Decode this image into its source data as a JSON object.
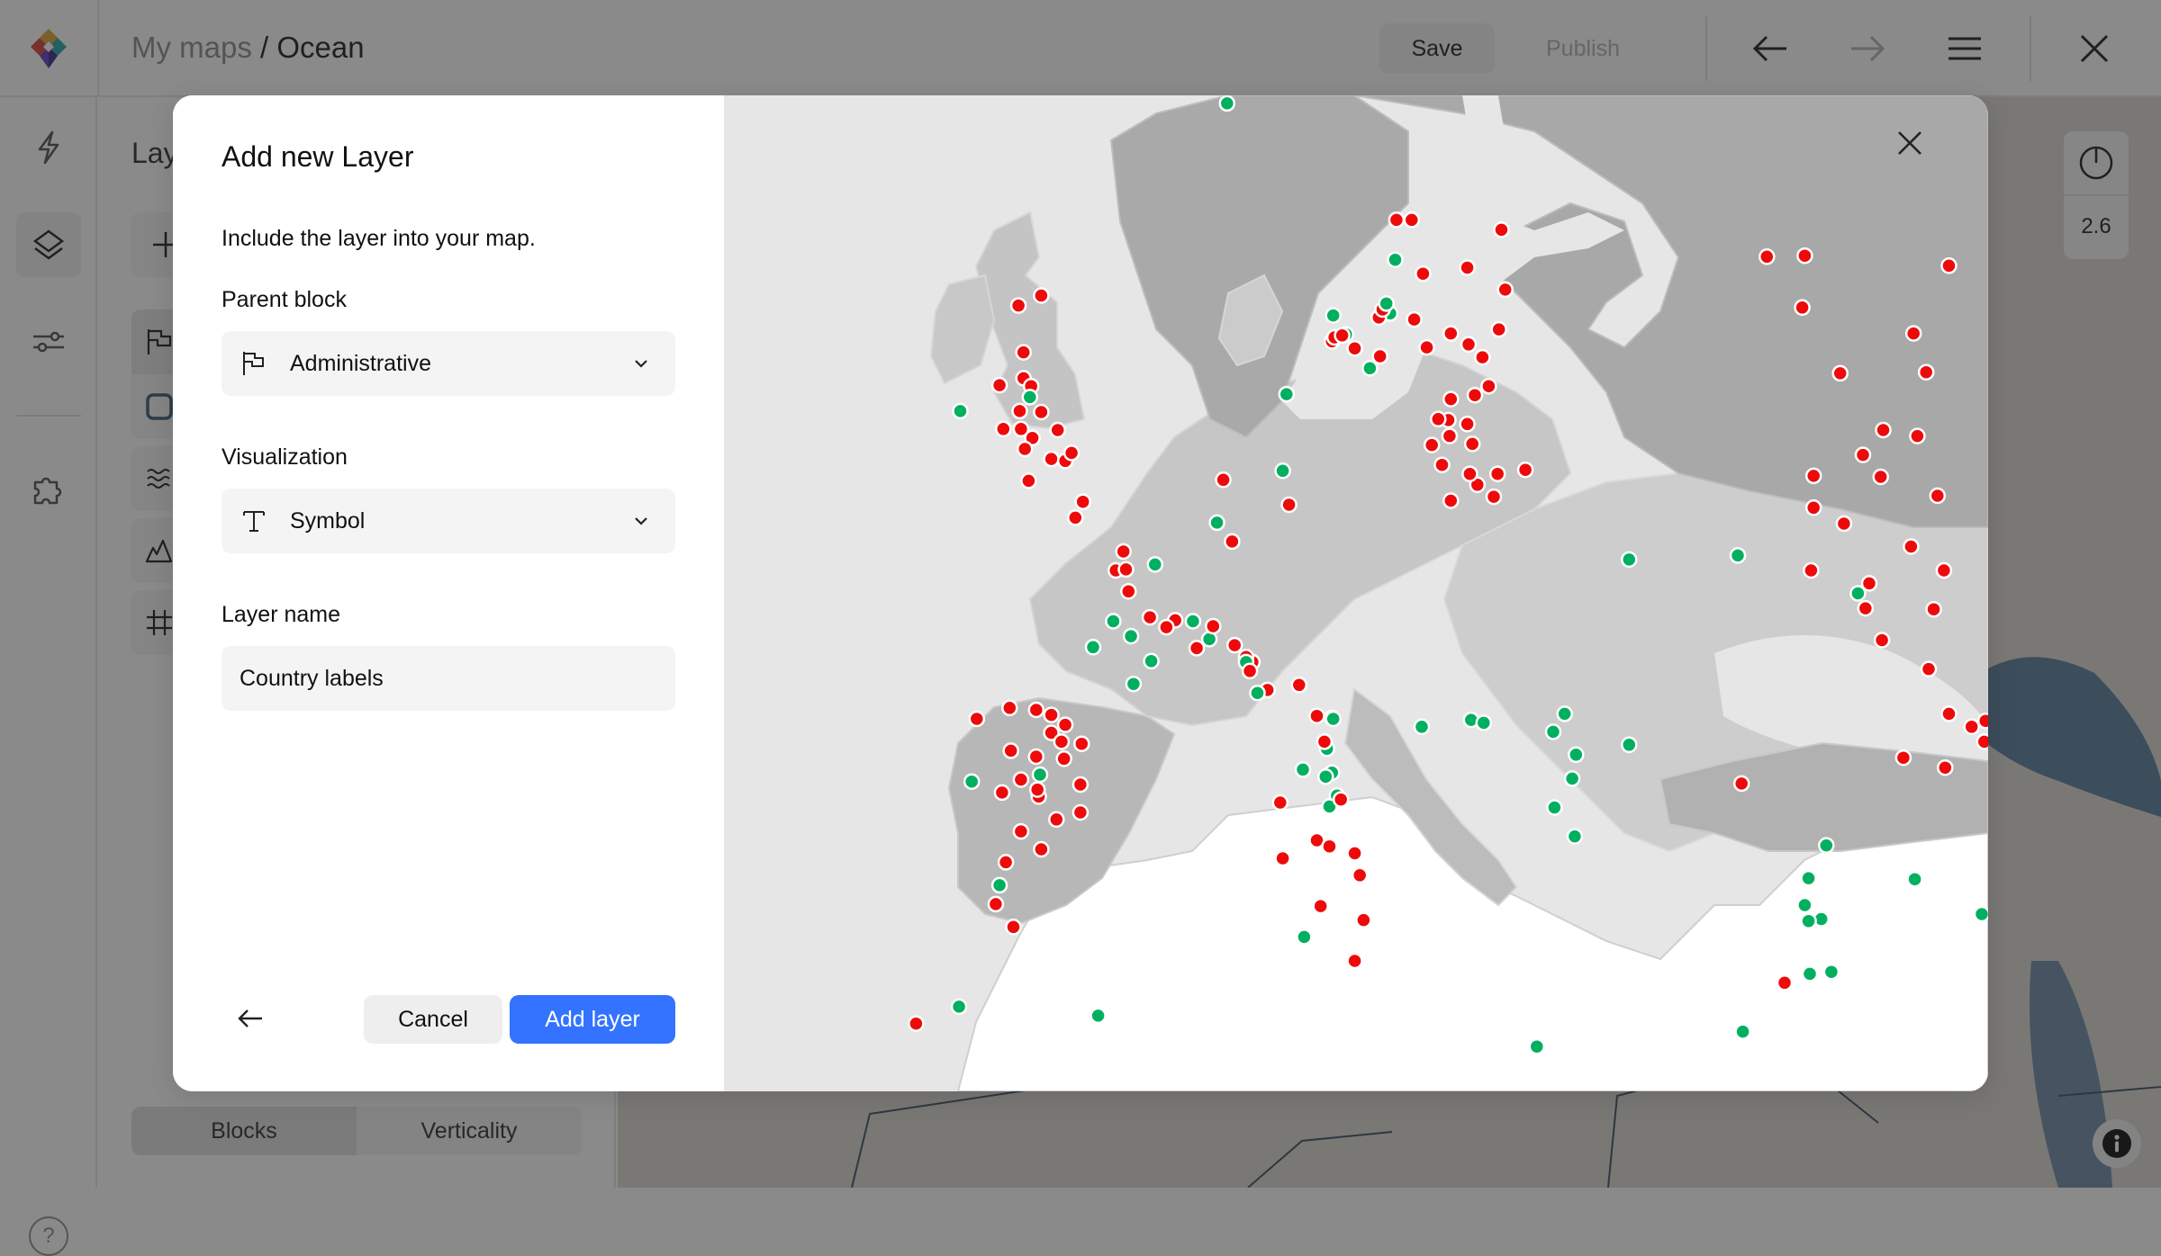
{
  "app": {
    "breadcrumb_parent": "My maps",
    "breadcrumb_separator": " / ",
    "map_name": "Ocean",
    "save_label": "Save",
    "publish_label": "Publish"
  },
  "rail": {
    "items": [
      {
        "icon": "lightning-icon",
        "active": false
      },
      {
        "icon": "layers-icon",
        "active": true
      },
      {
        "icon": "sliders-icon",
        "active": false
      },
      {
        "icon": "puzzle-icon",
        "active": false
      }
    ],
    "help_label": "?"
  },
  "panel": {
    "title": "Layers",
    "layer_icons": [
      "flag-icon",
      "square-icon",
      "waves-icon",
      "mountain-icon",
      "grid-icon"
    ],
    "tabs": [
      {
        "label": "Blocks",
        "active": true
      },
      {
        "label": "Verticality",
        "active": false
      }
    ]
  },
  "map": {
    "zoom_level": "2.6"
  },
  "modal": {
    "title": "Add new Layer",
    "subtitle": "Include the layer into your map.",
    "parent_block_label": "Parent block",
    "parent_block_value": "Administrative",
    "parent_block_icon": "flag-icon",
    "visualization_label": "Visualization",
    "visualization_value": "Symbol",
    "visualization_icon": "text-icon",
    "layer_name_label": "Layer name",
    "layer_name_value": "Country labels",
    "cancel_label": "Cancel",
    "add_label": "Add layer"
  },
  "colors": {
    "accent": "#3373ff",
    "marker_red": "#ee0a0a",
    "marker_green": "#00b060",
    "preview_sea": "#e6e6e6",
    "preview_land_dark": "#a6a6a6",
    "preview_land_light": "#d0d0d0",
    "preview_land_africa": "#ffffff"
  },
  "preview_markers": [
    {
      "s": "g",
      "x": 0.398,
      "y": 0.008
    },
    {
      "s": "r",
      "x": 0.233,
      "y": 0.211
    },
    {
      "s": "r",
      "x": 0.251,
      "y": 0.201
    },
    {
      "s": "r",
      "x": 0.237,
      "y": 0.258
    },
    {
      "s": "r",
      "x": 0.237,
      "y": 0.284
    },
    {
      "s": "r",
      "x": 0.243,
      "y": 0.292
    },
    {
      "s": "g",
      "x": 0.242,
      "y": 0.303
    },
    {
      "s": "r",
      "x": 0.218,
      "y": 0.291
    },
    {
      "s": "r",
      "x": 0.234,
      "y": 0.317
    },
    {
      "s": "g",
      "x": 0.187,
      "y": 0.317
    },
    {
      "s": "r",
      "x": 0.221,
      "y": 0.335
    },
    {
      "s": "r",
      "x": 0.235,
      "y": 0.335
    },
    {
      "s": "r",
      "x": 0.251,
      "y": 0.318
    },
    {
      "s": "r",
      "x": 0.244,
      "y": 0.344
    },
    {
      "s": "r",
      "x": 0.264,
      "y": 0.336
    },
    {
      "s": "r",
      "x": 0.259,
      "y": 0.365
    },
    {
      "s": "r",
      "x": 0.238,
      "y": 0.355
    },
    {
      "s": "r",
      "x": 0.241,
      "y": 0.387
    },
    {
      "s": "r",
      "x": 0.27,
      "y": 0.367
    },
    {
      "s": "r",
      "x": 0.275,
      "y": 0.359
    },
    {
      "s": "g",
      "x": 0.531,
      "y": 0.165
    },
    {
      "s": "r",
      "x": 0.532,
      "y": 0.125
    },
    {
      "s": "r",
      "x": 0.544,
      "y": 0.125
    },
    {
      "s": "r",
      "x": 0.615,
      "y": 0.135
    },
    {
      "s": "r",
      "x": 0.553,
      "y": 0.179
    },
    {
      "s": "r",
      "x": 0.588,
      "y": 0.173
    },
    {
      "s": "g",
      "x": 0.492,
      "y": 0.24
    },
    {
      "s": "r",
      "x": 0.481,
      "y": 0.247
    },
    {
      "s": "g",
      "x": 0.511,
      "y": 0.274
    },
    {
      "s": "r",
      "x": 0.483,
      "y": 0.243
    },
    {
      "s": "r",
      "x": 0.489,
      "y": 0.241
    },
    {
      "s": "r",
      "x": 0.499,
      "y": 0.254
    },
    {
      "s": "r",
      "x": 0.519,
      "y": 0.262
    },
    {
      "s": "r",
      "x": 0.546,
      "y": 0.225
    },
    {
      "s": "r",
      "x": 0.6,
      "y": 0.263
    },
    {
      "s": "r",
      "x": 0.618,
      "y": 0.195
    },
    {
      "s": "r",
      "x": 0.605,
      "y": 0.292
    },
    {
      "s": "r",
      "x": 0.613,
      "y": 0.235
    },
    {
      "s": "g",
      "x": 0.527,
      "y": 0.219
    },
    {
      "s": "r",
      "x": 0.518,
      "y": 0.223
    },
    {
      "s": "r",
      "x": 0.521,
      "y": 0.215
    },
    {
      "s": "g",
      "x": 0.524,
      "y": 0.209
    },
    {
      "s": "r",
      "x": 0.556,
      "y": 0.253
    },
    {
      "s": "r",
      "x": 0.575,
      "y": 0.239
    },
    {
      "s": "r",
      "x": 0.589,
      "y": 0.25
    },
    {
      "s": "r",
      "x": 0.594,
      "y": 0.301
    },
    {
      "s": "r",
      "x": 0.575,
      "y": 0.305
    },
    {
      "s": "r",
      "x": 0.573,
      "y": 0.326
    },
    {
      "s": "r",
      "x": 0.588,
      "y": 0.33
    },
    {
      "s": "r",
      "x": 0.574,
      "y": 0.342
    },
    {
      "s": "r",
      "x": 0.565,
      "y": 0.325
    },
    {
      "s": "r",
      "x": 0.568,
      "y": 0.371
    },
    {
      "s": "r",
      "x": 0.592,
      "y": 0.35
    },
    {
      "s": "r",
      "x": 0.596,
      "y": 0.391
    },
    {
      "s": "r",
      "x": 0.609,
      "y": 0.403
    },
    {
      "s": "r",
      "x": 0.634,
      "y": 0.376
    },
    {
      "s": "r",
      "x": 0.575,
      "y": 0.407
    },
    {
      "s": "r",
      "x": 0.612,
      "y": 0.38
    },
    {
      "s": "r",
      "x": 0.59,
      "y": 0.38
    },
    {
      "s": "r",
      "x": 0.56,
      "y": 0.351
    },
    {
      "s": "g",
      "x": 0.482,
      "y": 0.221
    },
    {
      "s": "g",
      "x": 0.445,
      "y": 0.3
    },
    {
      "s": "g",
      "x": 0.442,
      "y": 0.377
    },
    {
      "s": "r",
      "x": 0.447,
      "y": 0.411
    },
    {
      "s": "r",
      "x": 0.395,
      "y": 0.386
    },
    {
      "s": "r",
      "x": 0.402,
      "y": 0.448
    },
    {
      "s": "g",
      "x": 0.39,
      "y": 0.429
    },
    {
      "s": "g",
      "x": 0.341,
      "y": 0.471
    },
    {
      "s": "r",
      "x": 0.316,
      "y": 0.458
    },
    {
      "s": "g",
      "x": 0.371,
      "y": 0.528
    },
    {
      "s": "g",
      "x": 0.384,
      "y": 0.546
    },
    {
      "s": "g",
      "x": 0.338,
      "y": 0.568
    },
    {
      "s": "g",
      "x": 0.324,
      "y": 0.591
    },
    {
      "s": "g",
      "x": 0.322,
      "y": 0.543
    },
    {
      "s": "g",
      "x": 0.292,
      "y": 0.554
    },
    {
      "s": "g",
      "x": 0.308,
      "y": 0.528
    },
    {
      "s": "r",
      "x": 0.284,
      "y": 0.408
    },
    {
      "s": "r",
      "x": 0.278,
      "y": 0.424
    },
    {
      "s": "r",
      "x": 0.31,
      "y": 0.477
    },
    {
      "s": "r",
      "x": 0.32,
      "y": 0.498
    },
    {
      "s": "r",
      "x": 0.318,
      "y": 0.476
    },
    {
      "s": "r",
      "x": 0.337,
      "y": 0.524
    },
    {
      "s": "r",
      "x": 0.357,
      "y": 0.527
    },
    {
      "s": "r",
      "x": 0.35,
      "y": 0.534
    },
    {
      "s": "r",
      "x": 0.374,
      "y": 0.555
    },
    {
      "s": "r",
      "x": 0.387,
      "y": 0.533
    },
    {
      "s": "r",
      "x": 0.404,
      "y": 0.552
    },
    {
      "s": "r",
      "x": 0.418,
      "y": 0.569
    },
    {
      "s": "r",
      "x": 0.413,
      "y": 0.564
    },
    {
      "s": "g",
      "x": 0.413,
      "y": 0.569
    },
    {
      "s": "r",
      "x": 0.416,
      "y": 0.578
    },
    {
      "s": "r",
      "x": 0.43,
      "y": 0.597
    },
    {
      "s": "r",
      "x": 0.455,
      "y": 0.592
    },
    {
      "s": "r",
      "x": 0.481,
      "y": 0.625
    },
    {
      "s": "r",
      "x": 0.469,
      "y": 0.623
    },
    {
      "s": "g",
      "x": 0.481,
      "y": 0.68
    },
    {
      "s": "g",
      "x": 0.476,
      "y": 0.684
    },
    {
      "s": "g",
      "x": 0.477,
      "y": 0.656
    },
    {
      "s": "g",
      "x": 0.485,
      "y": 0.703
    },
    {
      "s": "g",
      "x": 0.479,
      "y": 0.714
    },
    {
      "s": "r",
      "x": 0.475,
      "y": 0.649
    },
    {
      "s": "r",
      "x": 0.488,
      "y": 0.707
    },
    {
      "s": "r",
      "x": 0.469,
      "y": 0.748
    },
    {
      "s": "r",
      "x": 0.479,
      "y": 0.754
    },
    {
      "s": "r",
      "x": 0.499,
      "y": 0.761
    },
    {
      "s": "r",
      "x": 0.503,
      "y": 0.783
    },
    {
      "s": "r",
      "x": 0.506,
      "y": 0.828
    },
    {
      "s": "r",
      "x": 0.499,
      "y": 0.869
    },
    {
      "s": "r",
      "x": 0.44,
      "y": 0.71
    },
    {
      "s": "r",
      "x": 0.442,
      "y": 0.766
    },
    {
      "s": "r",
      "x": 0.472,
      "y": 0.814
    },
    {
      "s": "g",
      "x": 0.422,
      "y": 0.6
    },
    {
      "s": "g",
      "x": 0.458,
      "y": 0.677
    },
    {
      "s": "g",
      "x": 0.482,
      "y": 0.626
    },
    {
      "s": "g",
      "x": 0.552,
      "y": 0.634
    },
    {
      "s": "g",
      "x": 0.591,
      "y": 0.627
    },
    {
      "s": "g",
      "x": 0.601,
      "y": 0.63
    },
    {
      "s": "g",
      "x": 0.656,
      "y": 0.639
    },
    {
      "s": "g",
      "x": 0.665,
      "y": 0.621
    },
    {
      "s": "g",
      "x": 0.674,
      "y": 0.662
    },
    {
      "s": "g",
      "x": 0.673,
      "y": 0.744
    },
    {
      "s": "g",
      "x": 0.657,
      "y": 0.715
    },
    {
      "s": "g",
      "x": 0.671,
      "y": 0.686
    },
    {
      "s": "g",
      "x": 0.716,
      "y": 0.652
    },
    {
      "s": "g",
      "x": 0.716,
      "y": 0.466
    },
    {
      "s": "g",
      "x": 0.802,
      "y": 0.462
    },
    {
      "s": "g",
      "x": 0.897,
      "y": 0.5
    },
    {
      "s": "r",
      "x": 0.805,
      "y": 0.691
    },
    {
      "s": "g",
      "x": 0.872,
      "y": 0.753
    },
    {
      "s": "r",
      "x": 0.2,
      "y": 0.626
    },
    {
      "s": "r",
      "x": 0.226,
      "y": 0.615
    },
    {
      "s": "r",
      "x": 0.247,
      "y": 0.617
    },
    {
      "s": "r",
      "x": 0.259,
      "y": 0.622
    },
    {
      "s": "r",
      "x": 0.259,
      "y": 0.64
    },
    {
      "s": "r",
      "x": 0.27,
      "y": 0.632
    },
    {
      "s": "r",
      "x": 0.267,
      "y": 0.649
    },
    {
      "s": "r",
      "x": 0.247,
      "y": 0.664
    },
    {
      "s": "r",
      "x": 0.269,
      "y": 0.666
    },
    {
      "s": "r",
      "x": 0.283,
      "y": 0.651
    },
    {
      "s": "r",
      "x": 0.227,
      "y": 0.658
    },
    {
      "s": "r",
      "x": 0.235,
      "y": 0.687
    },
    {
      "s": "r",
      "x": 0.249,
      "y": 0.704
    },
    {
      "s": "r",
      "x": 0.282,
      "y": 0.692
    },
    {
      "s": "r",
      "x": 0.248,
      "y": 0.697
    },
    {
      "s": "r",
      "x": 0.22,
      "y": 0.7
    },
    {
      "s": "g",
      "x": 0.196,
      "y": 0.689
    },
    {
      "s": "g",
      "x": 0.25,
      "y": 0.682
    },
    {
      "s": "r",
      "x": 0.235,
      "y": 0.739
    },
    {
      "s": "r",
      "x": 0.282,
      "y": 0.72
    },
    {
      "s": "r",
      "x": 0.263,
      "y": 0.727
    },
    {
      "s": "r",
      "x": 0.223,
      "y": 0.77
    },
    {
      "s": "r",
      "x": 0.251,
      "y": 0.757
    },
    {
      "s": "g",
      "x": 0.218,
      "y": 0.793
    },
    {
      "s": "r",
      "x": 0.215,
      "y": 0.812
    },
    {
      "s": "r",
      "x": 0.229,
      "y": 0.835
    },
    {
      "s": "g",
      "x": 0.186,
      "y": 0.915
    },
    {
      "s": "g",
      "x": 0.296,
      "y": 0.924
    },
    {
      "s": "g",
      "x": 0.459,
      "y": 0.845
    },
    {
      "s": "g",
      "x": 0.643,
      "y": 0.955
    },
    {
      "s": "g",
      "x": 0.806,
      "y": 0.94
    },
    {
      "s": "r",
      "x": 0.839,
      "y": 0.891
    },
    {
      "s": "g",
      "x": 0.858,
      "y": 0.829
    },
    {
      "s": "g",
      "x": 0.868,
      "y": 0.827
    },
    {
      "s": "g",
      "x": 0.859,
      "y": 0.882
    },
    {
      "s": "g",
      "x": 0.876,
      "y": 0.88
    },
    {
      "s": "g",
      "x": 0.858,
      "y": 0.829
    },
    {
      "s": "g",
      "x": 0.858,
      "y": 0.786
    },
    {
      "s": "g",
      "x": 0.855,
      "y": 0.813
    },
    {
      "s": "g",
      "x": 0.942,
      "y": 0.787
    },
    {
      "s": "g",
      "x": 0.995,
      "y": 0.822
    },
    {
      "s": "r",
      "x": 0.152,
      "y": 0.932
    },
    {
      "s": "r",
      "x": 0.825,
      "y": 0.162
    },
    {
      "s": "r",
      "x": 0.855,
      "y": 0.161
    },
    {
      "s": "r",
      "x": 0.969,
      "y": 0.171
    },
    {
      "s": "r",
      "x": 0.853,
      "y": 0.213
    },
    {
      "s": "r",
      "x": 0.941,
      "y": 0.239
    },
    {
      "s": "r",
      "x": 0.883,
      "y": 0.279
    },
    {
      "s": "r",
      "x": 0.951,
      "y": 0.278
    },
    {
      "s": "r",
      "x": 0.917,
      "y": 0.336
    },
    {
      "s": "r",
      "x": 0.944,
      "y": 0.342
    },
    {
      "s": "r",
      "x": 0.862,
      "y": 0.382
    },
    {
      "s": "r",
      "x": 0.915,
      "y": 0.383
    },
    {
      "s": "r",
      "x": 0.901,
      "y": 0.361
    },
    {
      "s": "r",
      "x": 0.96,
      "y": 0.402
    },
    {
      "s": "r",
      "x": 0.862,
      "y": 0.414
    },
    {
      "s": "r",
      "x": 0.886,
      "y": 0.43
    },
    {
      "s": "r",
      "x": 0.939,
      "y": 0.453
    },
    {
      "s": "r",
      "x": 0.86,
      "y": 0.477
    },
    {
      "s": "r",
      "x": 0.965,
      "y": 0.477
    },
    {
      "s": "r",
      "x": 0.906,
      "y": 0.49
    },
    {
      "s": "r",
      "x": 0.903,
      "y": 0.515
    },
    {
      "s": "r",
      "x": 0.957,
      "y": 0.516
    },
    {
      "s": "r",
      "x": 0.953,
      "y": 0.576
    },
    {
      "s": "r",
      "x": 0.916,
      "y": 0.547
    },
    {
      "s": "r",
      "x": 0.998,
      "y": 0.628
    },
    {
      "s": "r",
      "x": 0.987,
      "y": 0.634
    },
    {
      "s": "r",
      "x": 0.969,
      "y": 0.621
    },
    {
      "s": "r",
      "x": 0.997,
      "y": 0.649
    },
    {
      "s": "r",
      "x": 0.966,
      "y": 0.675
    },
    {
      "s": "r",
      "x": 0.933,
      "y": 0.665
    }
  ]
}
